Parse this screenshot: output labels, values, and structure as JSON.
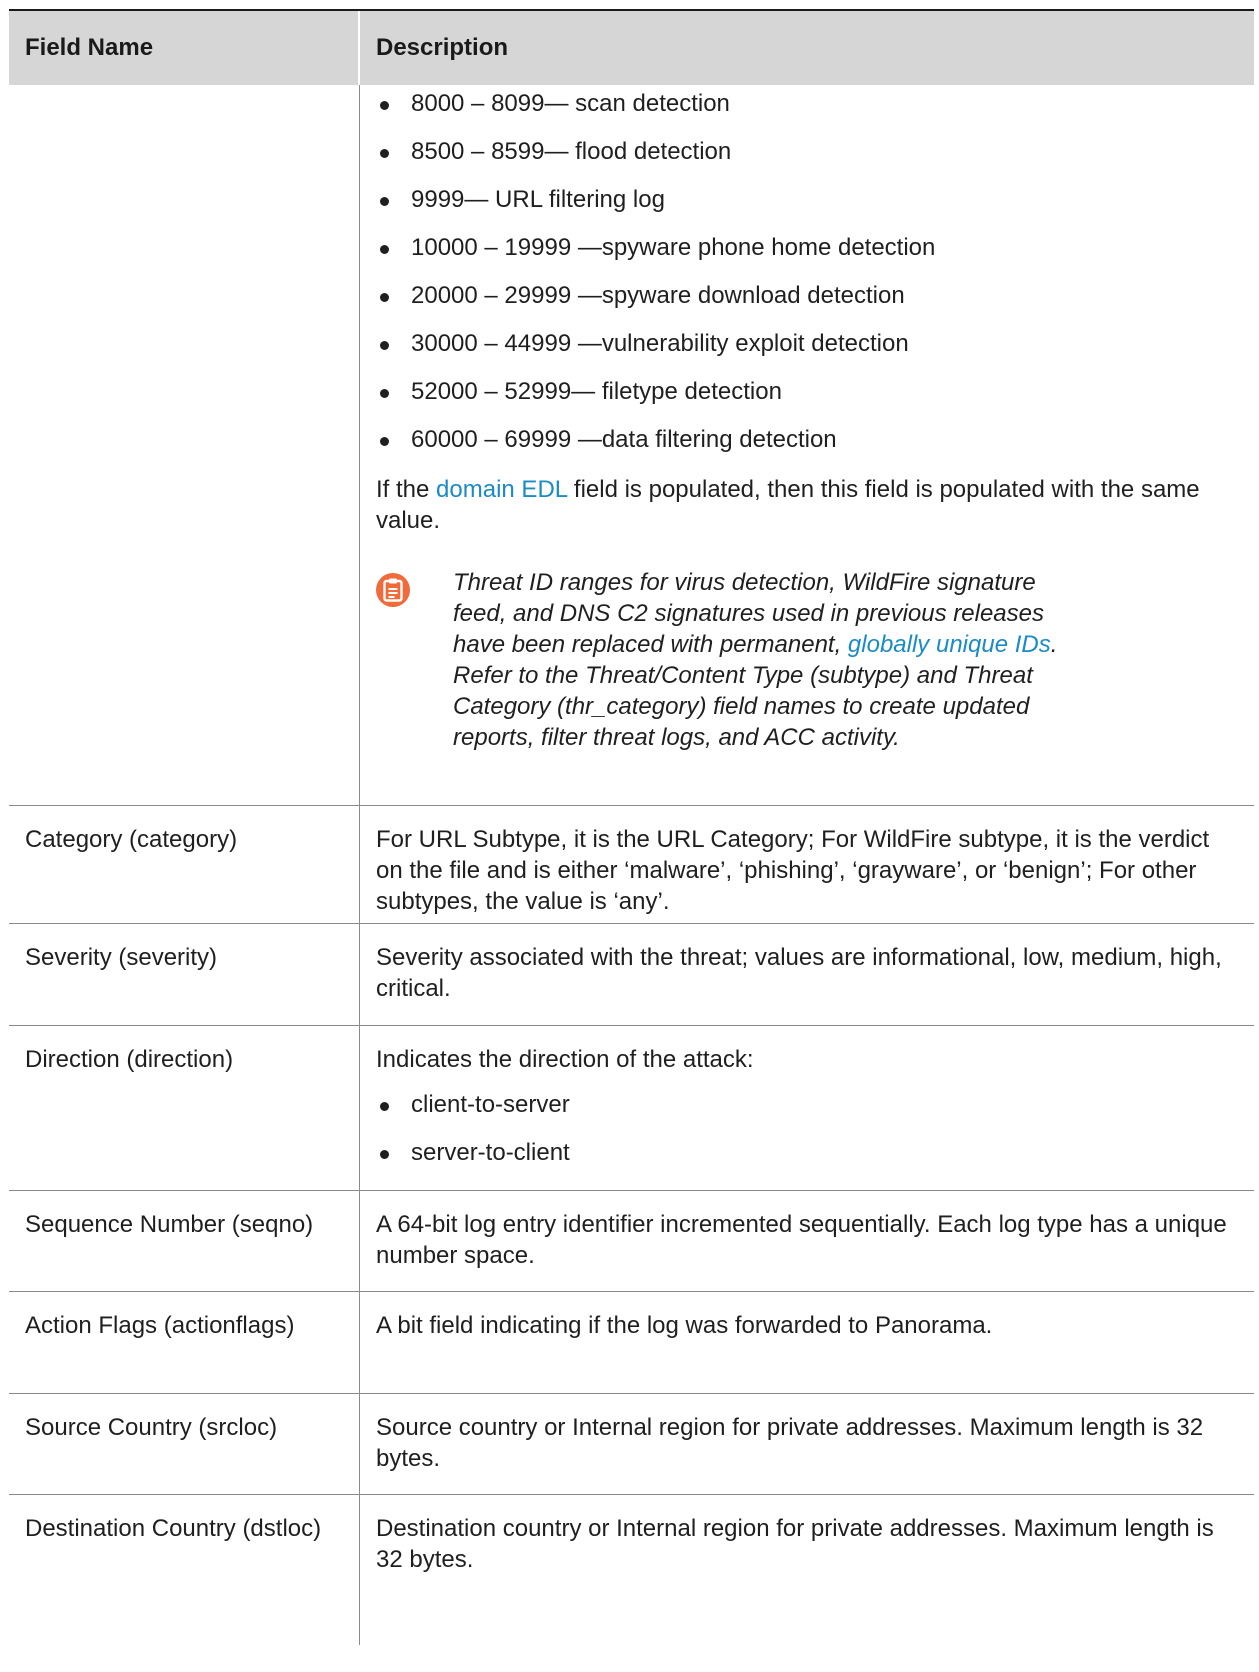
{
  "header": {
    "col1": "Field Name",
    "col2": "Description"
  },
  "threat_row": {
    "bullets": [
      "8000 – 8099— scan detection",
      "8500 – 8599— flood detection",
      "9999— URL filtering log",
      "10000 – 19999 —spyware phone home detection",
      "20000 – 29999 —spyware download detection",
      "30000 – 44999 —vulnerability exploit detection",
      "52000 – 52999— filetype detection",
      "60000 – 69999 —data filtering detection"
    ],
    "edl_pre": "If the ",
    "edl_link": "domain EDL",
    "edl_post": " field is populated, then this field is populated with the same value.",
    "note_icon": "clipboard-icon",
    "note_pre": "Threat ID ranges for virus detection, WildFire signature feed, and DNS C2 signatures used in previous releases have been replaced with permanent, ",
    "note_link": "globally unique IDs",
    "note_post": ". Refer to the Threat/Content Type (subtype) and Threat Category (thr_category) field names to create updated reports, filter threat logs, and ACC activity."
  },
  "rows": [
    {
      "field": "Category (category)",
      "desc": "For URL Subtype, it is the URL Category; For WildFire subtype, it is the verdict on the file and is either ‘malware’, ‘phishing’, ‘grayware’, or ‘benign’; For other subtypes, the value is ‘any’."
    },
    {
      "field": "Severity (severity)",
      "desc": "Severity associated with the threat; values are informational, low, medium, high, critical."
    },
    {
      "field": "Direction (direction)",
      "desc": "Indicates the direction of the attack:",
      "bullets": [
        "client-to-server",
        "server-to-client"
      ]
    },
    {
      "field": "Sequence Number (seqno)",
      "desc": "A 64-bit log entry identifier incremented sequentially. Each log type has a unique number space."
    },
    {
      "field": "Action Flags (actionflags)",
      "desc": "A bit field indicating if the log was forwarded to Panorama."
    },
    {
      "field": "Source Country (srcloc)",
      "desc": "Source country or Internal region for private addresses. Maximum length is 32 bytes."
    },
    {
      "field": "Destination Country (dstloc)",
      "desc": "Destination country or Internal region for private addresses. Maximum length is 32 bytes."
    }
  ],
  "colors": {
    "link": "#1b8bc6",
    "note_icon": "#f06a3a",
    "header_bg": "#d6d6d6"
  }
}
